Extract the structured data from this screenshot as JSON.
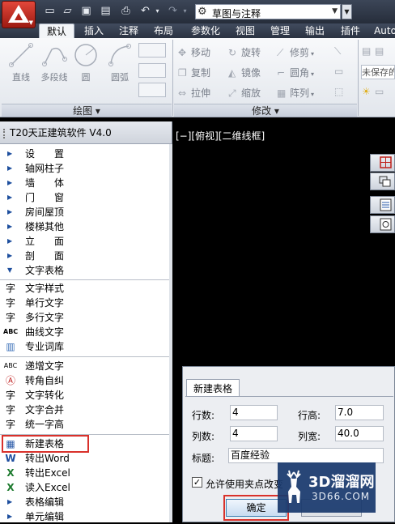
{
  "quick_access": {
    "workspace": "草图与注释"
  },
  "ribbon_tabs": [
    "默认",
    "插入",
    "注释",
    "布局",
    "参数化",
    "视图",
    "管理",
    "输出",
    "插件",
    "Auto"
  ],
  "draw_panel": {
    "tools": [
      "直线",
      "多段线",
      "圆",
      "圆弧"
    ],
    "title": "绘图 ▾"
  },
  "modify_panel": {
    "rows": [
      [
        "移动",
        "旋转",
        "修剪"
      ],
      [
        "复制",
        "镜像",
        "圆角"
      ],
      [
        "拉伸",
        "缩放",
        "阵列"
      ]
    ],
    "title": "修改 ▾"
  },
  "right_panel": {
    "unsaved": "未保存的"
  },
  "palette": {
    "title": "T20天正建筑软件 V4.0",
    "top_items": [
      "设　　置",
      "轴网柱子",
      "墙　　体",
      "门　　窗",
      "房间屋顶",
      "楼梯其他",
      "立　　面",
      "剖　　面",
      "文字表格"
    ],
    "text_items": [
      "文字样式",
      "单行文字",
      "多行文字",
      "曲线文字",
      "专业词库"
    ],
    "edit_items": [
      "递增文字",
      "转角自纠",
      "文字转化",
      "文字合并",
      "统一字高"
    ],
    "table_items": [
      "新建表格",
      "转出Word",
      "转出Excel",
      "读入Excel",
      "表格编辑",
      "单元编辑"
    ]
  },
  "canvas": {
    "view_label": "[−][俯视][二维线框]"
  },
  "dialog": {
    "tab": "新建表格",
    "rows_label": "行数:",
    "rows_value": "4",
    "row_height_label": "行高:",
    "row_height_value": "7.0",
    "cols_label": "列数:",
    "cols_value": "4",
    "col_width_label": "列宽:",
    "col_width_value": "40.0",
    "title_label": "标题:",
    "title_value": "百度经验",
    "checkbox_label": "允许使用夹点改变",
    "checkbox_checked": true,
    "ok": "确定"
  },
  "watermark": {
    "line1": "3D溜溜网",
    "line2": "3D66.COM"
  }
}
